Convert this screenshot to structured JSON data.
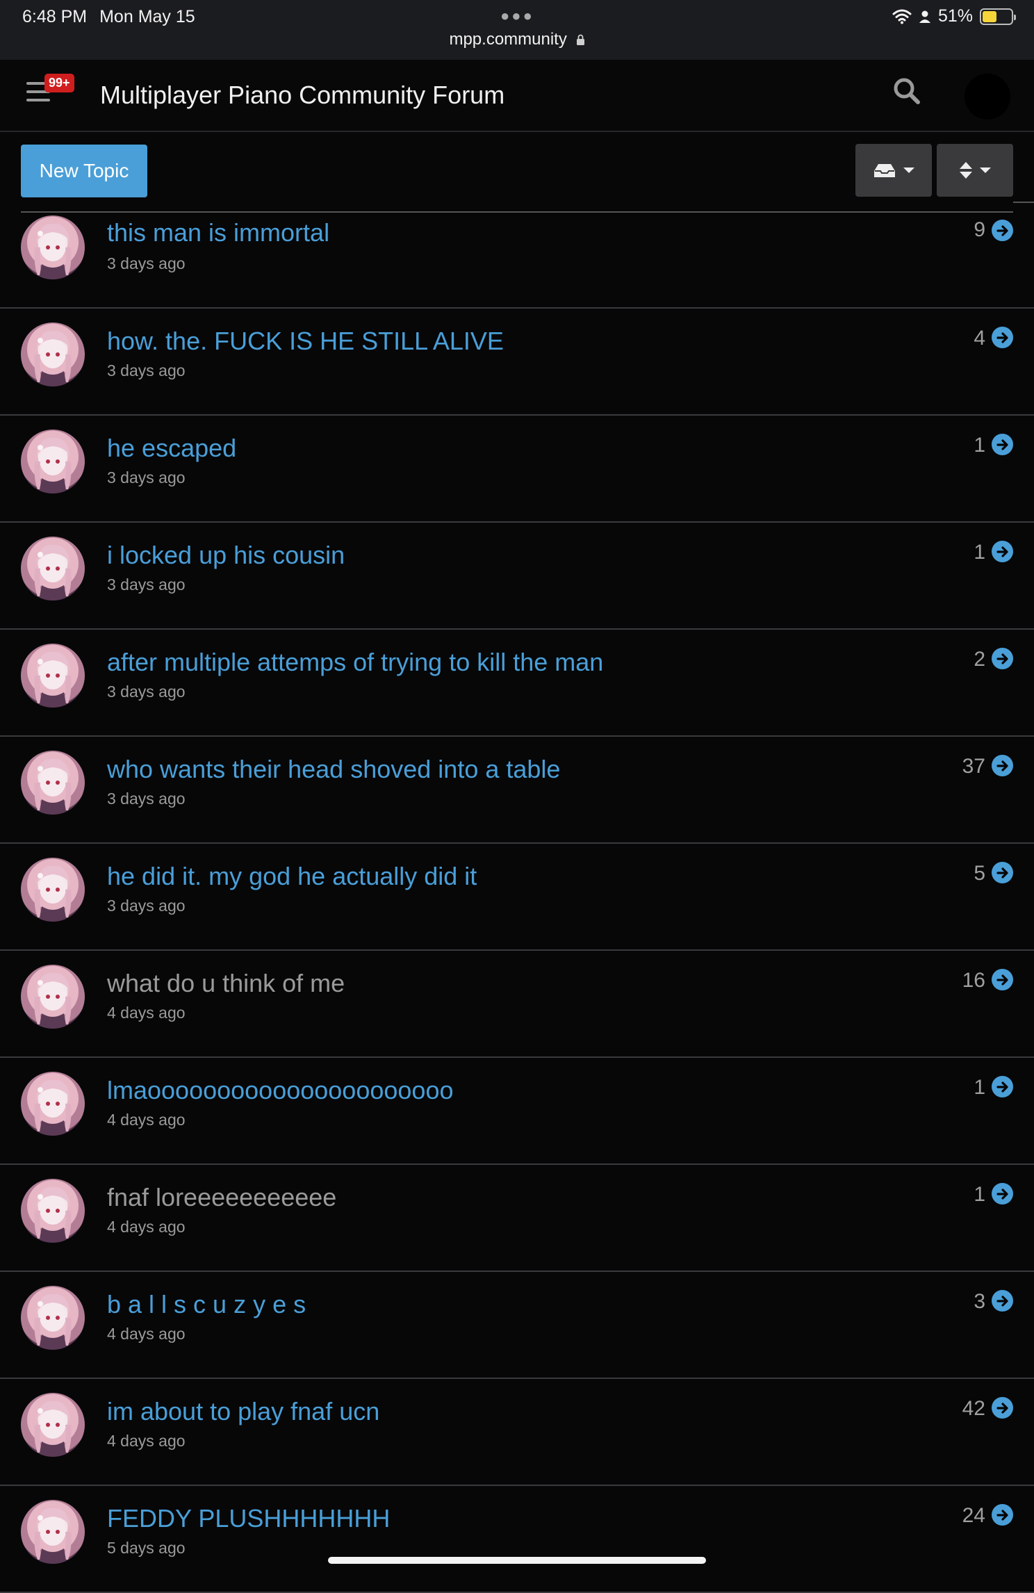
{
  "status_bar": {
    "time": "6:48 PM",
    "date": "Mon May 15",
    "url": "mpp.community",
    "battery": "51%",
    "battery_level": 0.51
  },
  "header": {
    "notification_badge": "99+",
    "title": "Multiplayer Piano Community Forum"
  },
  "toolbar": {
    "new_topic_label": "New Topic"
  },
  "topics": [
    {
      "title": "this man is immortal",
      "time": "3 days ago",
      "count": "9",
      "read": false
    },
    {
      "title": "how. the. FUCK IS HE STILL ALIVE",
      "time": "3 days ago",
      "count": "4",
      "read": false
    },
    {
      "title": "he escaped",
      "time": "3 days ago",
      "count": "1",
      "read": false
    },
    {
      "title": "i locked up his cousin",
      "time": "3 days ago",
      "count": "1",
      "read": false
    },
    {
      "title": "after multiple attemps of trying to kill the man",
      "time": "3 days ago",
      "count": "2",
      "read": false
    },
    {
      "title": "who wants their head shoved into a table",
      "time": "3 days ago",
      "count": "37",
      "read": false
    },
    {
      "title": "he did it. my god he actually did it",
      "time": "3 days ago",
      "count": "5",
      "read": false
    },
    {
      "title": "what do u think of me",
      "time": "4 days ago",
      "count": "16",
      "read": true
    },
    {
      "title": "lmaoooooooooooooooooooooo",
      "time": "4 days ago",
      "count": "1",
      "read": false
    },
    {
      "title": "fnaf loreeeeeeeeeee",
      "time": "4 days ago",
      "count": "1",
      "read": true
    },
    {
      "title": "b a l l s c u z y e s",
      "time": "4 days ago",
      "count": "3",
      "read": false
    },
    {
      "title": "im about to play fnaf ucn",
      "time": "4 days ago",
      "count": "42",
      "read": false
    },
    {
      "title": "FEDDY PLUSHHHHHHH",
      "time": "5 days ago",
      "count": "24",
      "read": false
    }
  ],
  "colors": {
    "accent": "#4a9fd8",
    "background": "#070708",
    "badge": "#d01e1e"
  }
}
